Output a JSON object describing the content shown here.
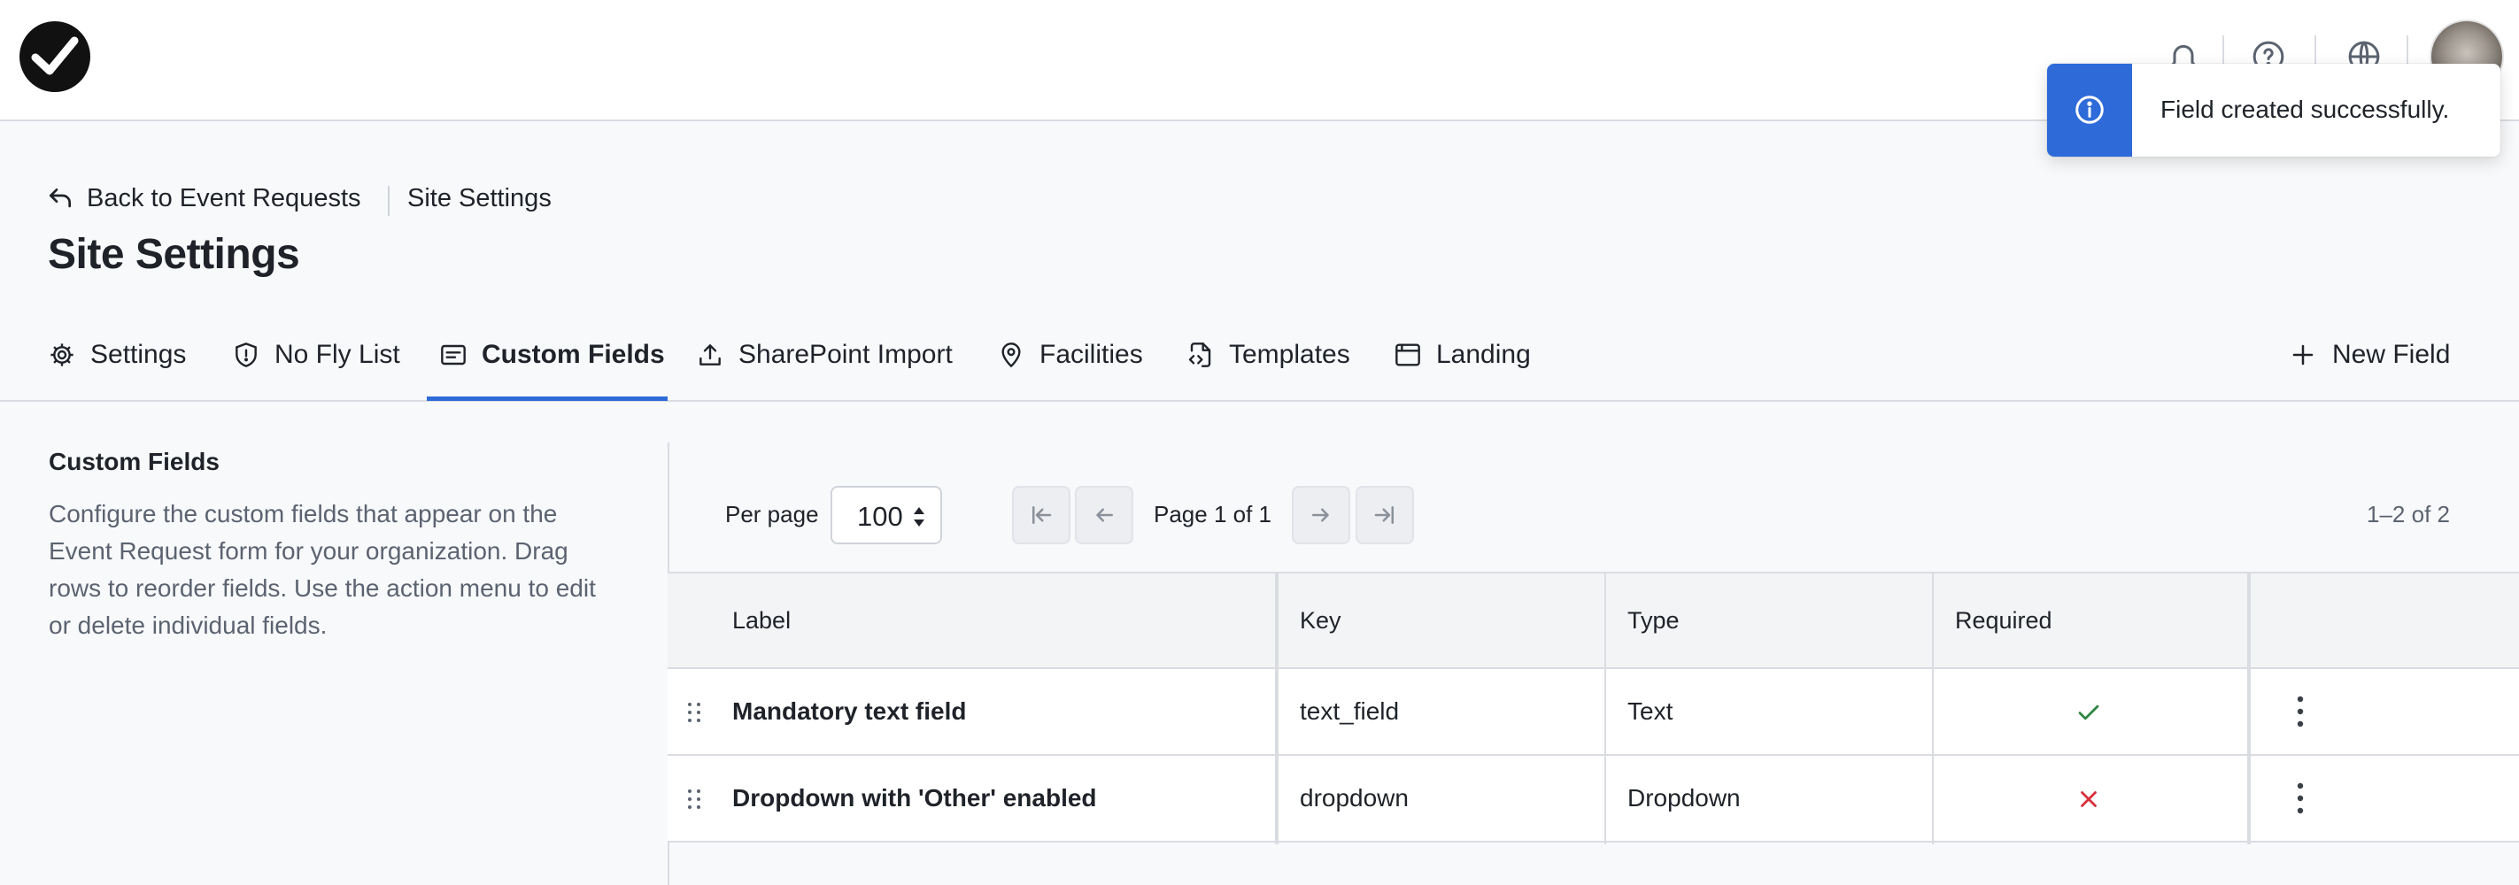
{
  "header": {
    "logo_icon": "check-circle-logo-icon",
    "icons": [
      "bell-icon",
      "help-circle-icon",
      "globe-icon"
    ],
    "avatar": "user-avatar"
  },
  "toast": {
    "icon": "info-icon",
    "message": "Field created successfully.",
    "accent_color": "#2e6bd9"
  },
  "breadcrumb": {
    "back_label": "Back to Event Requests",
    "current": "Site Settings"
  },
  "page_title": "Site Settings",
  "tabs": [
    {
      "label": "Settings",
      "icon": "gear-icon",
      "active": false
    },
    {
      "label": "No Fly List",
      "icon": "shield-icon",
      "active": false
    },
    {
      "label": "Custom Fields",
      "icon": "form-icon",
      "active": true
    },
    {
      "label": "SharePoint Import",
      "icon": "upload-icon",
      "active": false
    },
    {
      "label": "Facilities",
      "icon": "map-pin-icon",
      "active": false
    },
    {
      "label": "Templates",
      "icon": "file-code-icon",
      "active": false
    },
    {
      "label": "Landing",
      "icon": "browser-window-icon",
      "active": false
    }
  ],
  "new_field_label": "New Field",
  "side_panel": {
    "title": "Custom Fields",
    "description": "Configure the custom fields that appear on the Event Request form for your organization. Drag rows to reorder fields. Use the action menu to edit or delete individual fields."
  },
  "pagination": {
    "per_page_label": "Per page",
    "per_page_value": "100",
    "page_info": "Page 1 of 1",
    "range": "1–2 of 2"
  },
  "table": {
    "columns": [
      "Label",
      "Key",
      "Type",
      "Required",
      ""
    ],
    "rows": [
      {
        "label": "Mandatory text field",
        "key": "text_field",
        "type": "Text",
        "required": true
      },
      {
        "label": "Dropdown with 'Other' enabled",
        "key": "dropdown",
        "type": "Dropdown",
        "required": false
      }
    ]
  },
  "colors": {
    "accent": "#2e6bd9",
    "required_yes": "#2e8540",
    "required_no": "#d62f3c"
  }
}
